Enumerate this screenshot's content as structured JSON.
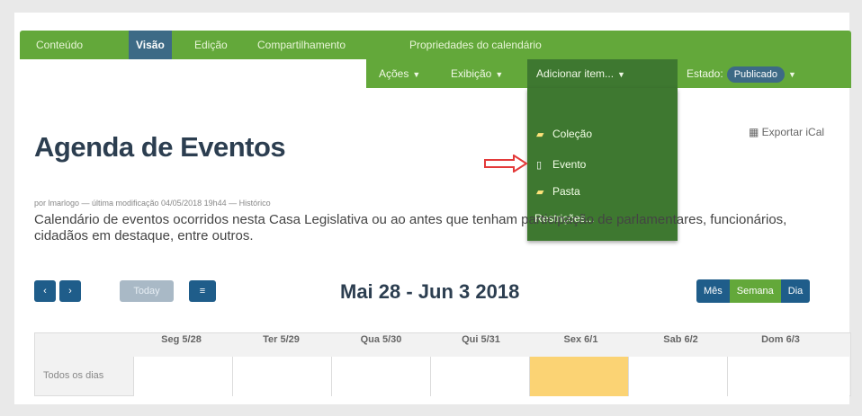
{
  "top_tabs": [
    "Conteúdo",
    "Visão",
    "Edição",
    "Compartilhamento",
    "Propriedades do calendário"
  ],
  "sub_menu": {
    "acoes": "Ações",
    "exibicao": "Exibição",
    "adicionar": "Adicionar item...",
    "estado_label": "Estado:",
    "estado_value": "Publicado"
  },
  "dropdown": {
    "items": [
      {
        "icon": "folder-icon",
        "label": "Coleção"
      },
      {
        "icon": "file-icon",
        "label": "Evento"
      },
      {
        "icon": "folder-icon",
        "label": "Pasta"
      }
    ],
    "restrictions": "Restrições..."
  },
  "export": "Exportar iCal",
  "page": {
    "title": "Agenda de Eventos",
    "byline": "por lmarlogo — última modificação 04/05/2018 19h44 — Histórico",
    "description": "Calendário de eventos ocorridos nesta Casa Legislativa ou ao                                  antes que tenham participação de parlamentares, funcionários, cidadãos em destaque, entre outros."
  },
  "calendar": {
    "nav_prev": "‹",
    "nav_next": "›",
    "today": "Today",
    "list": "≡",
    "range": "Mai 28 - Jun 3 2018",
    "views": [
      "Mês",
      "Semana",
      "Dia"
    ],
    "all_day": "Todos os dias",
    "days": [
      "Seg 5/28",
      "Ter 5/29",
      "Qua 5/30",
      "Qui 5/31",
      "Sex 6/1",
      "Sab 6/2",
      "Dom 6/3"
    ],
    "today_index": 4
  },
  "colors": {
    "bar_green": "#63a83a",
    "active_blue": "#3d6a86",
    "dropdown_green": "#3e7830",
    "today_yellow": "#fbd374",
    "arrow_red": "#e33a3a"
  }
}
